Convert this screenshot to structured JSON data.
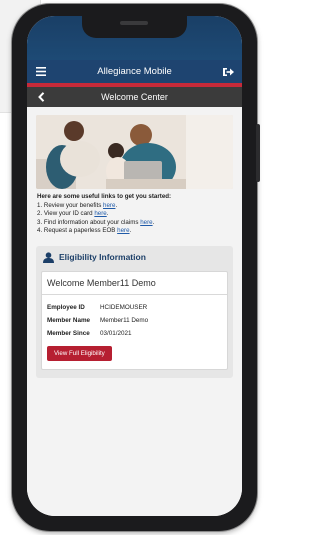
{
  "app": {
    "title": "Allegiance Mobile"
  },
  "subheader": {
    "title": "Welcome Center"
  },
  "links": {
    "intro": "Here are some useful links to get you started:",
    "items": [
      {
        "text": "1. Review your benefits ",
        "link": "here",
        "end": "."
      },
      {
        "text": "2. View your ID card ",
        "link": "here",
        "end": "."
      },
      {
        "text": "3. Find information about your claims ",
        "link": "here",
        "end": "."
      },
      {
        "text": "4. Request a paperless EOB ",
        "link": "here",
        "end": "."
      }
    ]
  },
  "eligibility": {
    "heading": "Eligibility Information",
    "welcome": "Welcome Member11 Demo",
    "fields": [
      {
        "label": "Employee ID",
        "value": "HCIDEMOUSER"
      },
      {
        "label": "Member Name",
        "value": "Member11 Demo"
      },
      {
        "label": "Member Since",
        "value": "03/01/2021"
      }
    ],
    "button": "View Full Eligibility"
  },
  "colors": {
    "brand_blue": "#1e4470",
    "accent_red": "#c72a39",
    "button_red": "#b61f31"
  },
  "icons": [
    "menu-icon",
    "logout-icon",
    "back-chevron-icon",
    "user-icon"
  ]
}
